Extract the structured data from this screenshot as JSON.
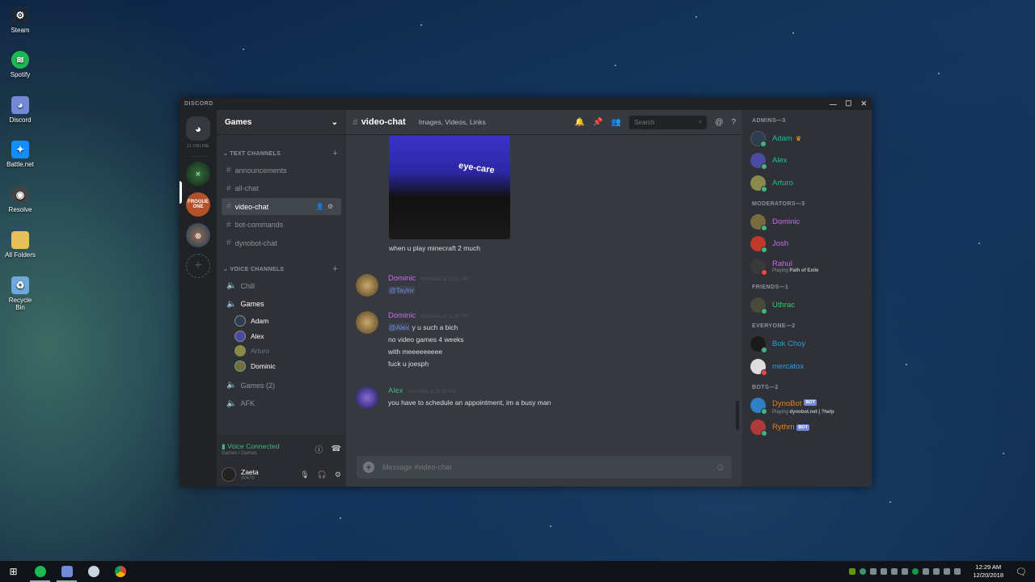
{
  "desktop": {
    "icons": [
      {
        "label": "Steam",
        "color": "#1b2838"
      },
      {
        "label": "Spotify",
        "color": "#1db954"
      },
      {
        "label": "Discord",
        "color": "#7289da"
      },
      {
        "label": "Battle.net",
        "color": "#148eff"
      },
      {
        "label": "Resolve",
        "color": "#444"
      },
      {
        "label": "All Folders",
        "color": "#e6c15a"
      },
      {
        "label": "Recycle Bin",
        "color": "#6fa8dc"
      }
    ]
  },
  "window": {
    "title": "DISCORD",
    "controls": {
      "minimize": "—",
      "maximize": "☐",
      "close": "✕"
    }
  },
  "guilds": {
    "online_count": "11 ONLINE",
    "server2_label": "FROGUE ONE",
    "add_symbol": "+"
  },
  "channels_panel": {
    "server_name": "Games",
    "text_category": "TEXT CHANNELS",
    "text_channels": [
      "announcements",
      "all-chat",
      "video-chat",
      "bot-commands",
      "dynobot-chat"
    ],
    "voice_category": "VOICE CHANNELS",
    "voice_channels": {
      "chill": "Chill",
      "games": "Games",
      "games_users": [
        "Adam",
        "Alex",
        "Arturo",
        "Dominic"
      ],
      "games2": "Games (2)",
      "afk": "AFK"
    },
    "voice_status": "Voice Connected",
    "voice_location": "Games / Games",
    "user": {
      "name": "Zaeta",
      "tag": "#0470"
    }
  },
  "chat": {
    "channel": "video-chat",
    "topic": "Images, Videos, Links",
    "search_placeholder": "Search",
    "image_caption": "eye-care",
    "first_line": "when u play minecraft 2 much",
    "messages": [
      {
        "author": "Dominic",
        "color": "#c86bf0",
        "time": "Yesterday at 10:31 PM",
        "mention": "@Taylor",
        "lines": []
      },
      {
        "author": "Dominic",
        "color": "#c86bf0",
        "time": "Yesterday at 11:30 PM",
        "mention": "@Alex",
        "first": "y u such a bich",
        "lines": [
          "no video games 4 weeks",
          "with meeeeeeeee",
          "fuck u joesph"
        ]
      },
      {
        "author": "Alex",
        "color": "#43b581",
        "time": "Yesterday at 11:38 PM",
        "first": "you have to schedule an appointment, im a busy man"
      }
    ],
    "composer_placeholder": "Message #video-chat"
  },
  "members": {
    "admins": "ADMINS—3",
    "moderators": "MODERATORS—3",
    "friends": "FRIENDS—1",
    "everyone": "EVERYONE—2",
    "bots": "BOTS—2",
    "list": {
      "adam": {
        "name": "Adam",
        "color": "#1abc9c",
        "crown": "♛"
      },
      "alex": {
        "name": "Alex",
        "color": "#1abc9c"
      },
      "arturo": {
        "name": "Arturo",
        "color": "#1abc9c"
      },
      "dominic": {
        "name": "Dominic",
        "color": "#c86bf0"
      },
      "josh": {
        "name": "Josh",
        "color": "#c86bf0"
      },
      "rahul": {
        "name": "Rahul",
        "color": "#c86bf0",
        "playing_prefix": "Playing",
        "game": "Path of Exile"
      },
      "uthrac": {
        "name": "Uthrac",
        "color": "#2ecc71"
      },
      "bokchoy": {
        "name": "Bok Choy",
        "color": "#3498db"
      },
      "mercatox": {
        "name": "mercatox",
        "color": "#3498db"
      },
      "dynobot": {
        "name": "DynoBot",
        "color": "#e67e22",
        "tag": "BOT",
        "playing_prefix": "Playing",
        "game": "dynobot.net | ?help"
      },
      "rythm": {
        "name": "Rythm",
        "color": "#e67e22",
        "tag": "BOT"
      }
    }
  },
  "taskbar": {
    "time": "12:29 AM",
    "date": "12/20/2018"
  }
}
